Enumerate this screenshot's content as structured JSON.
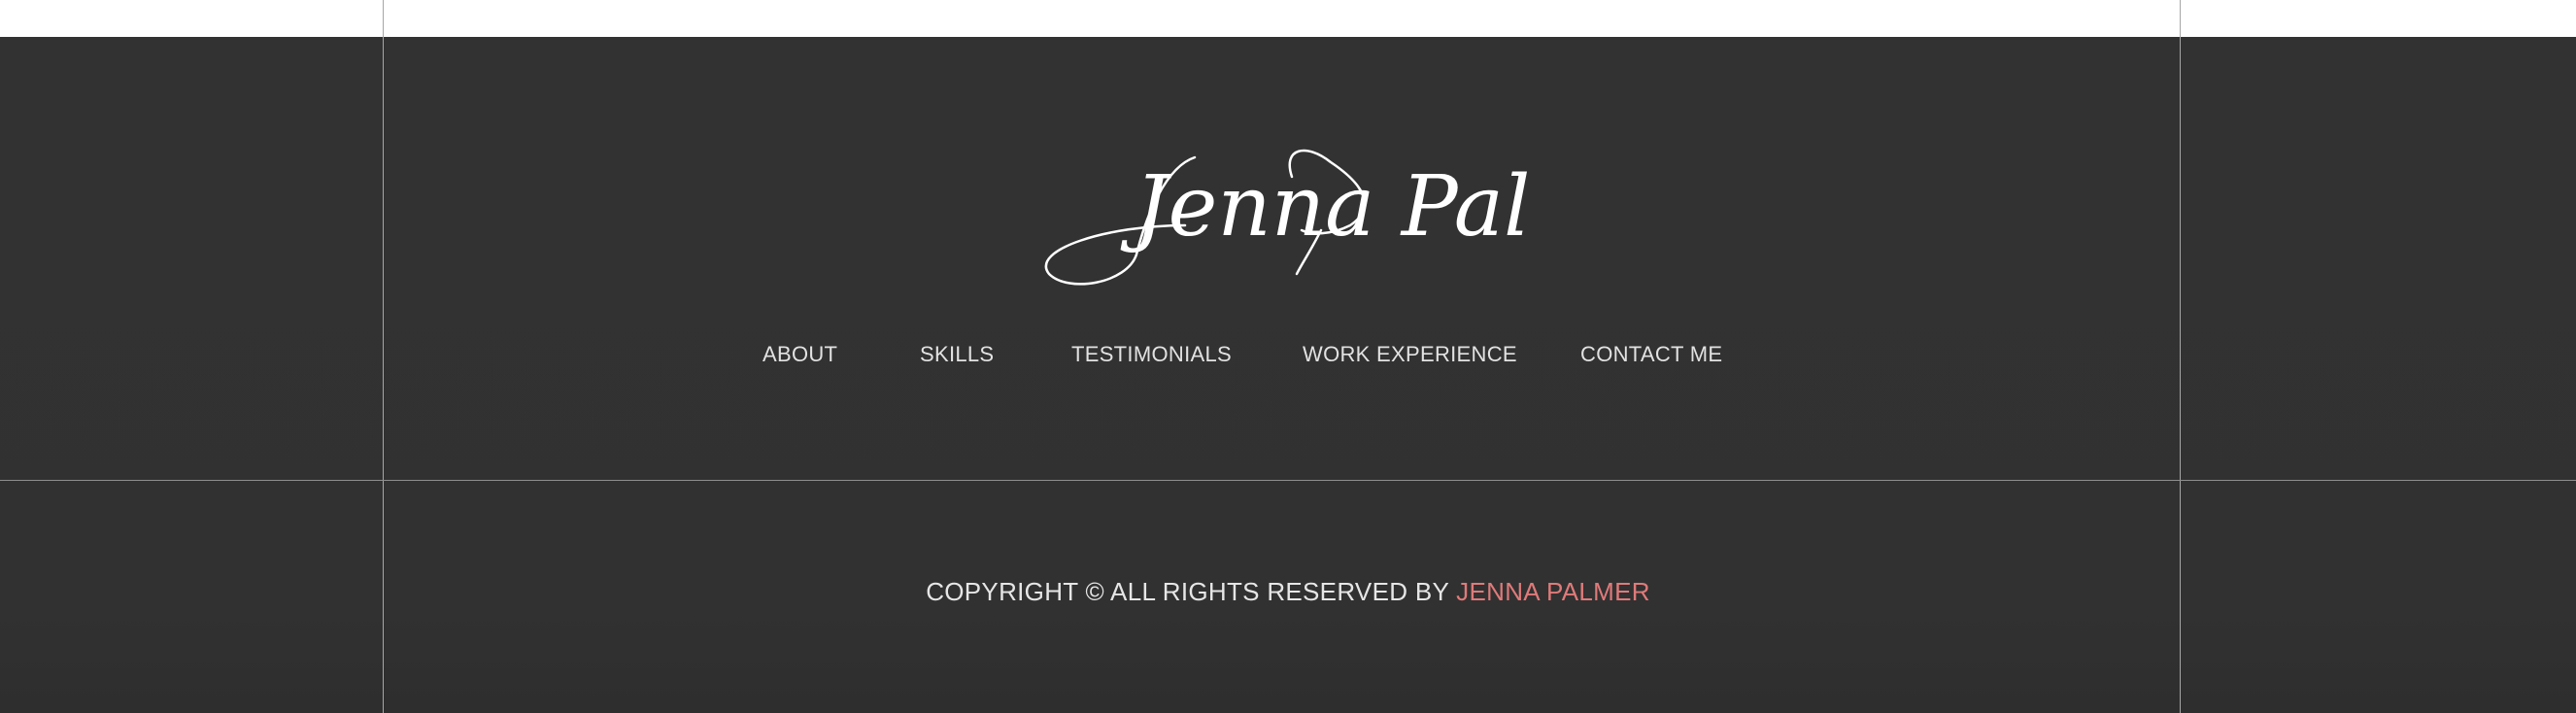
{
  "brand": {
    "signature_text": "Jenna Palmer"
  },
  "nav": {
    "items": [
      {
        "label": "ABOUT"
      },
      {
        "label": "SKILLS"
      },
      {
        "label": "TESTIMONIALS"
      },
      {
        "label": "WORK EXPERIENCE"
      },
      {
        "label": "CONTACT ME"
      }
    ]
  },
  "footer": {
    "copyright_prefix": "COPYRIGHT © ALL RIGHTS RESERVED BY",
    "copyright_owner": "JENNA PALMER"
  },
  "colors": {
    "background": "#323232",
    "text": "#e2e2e2",
    "accent": "#e07a7a",
    "grid_line": "#a6a6a6"
  }
}
